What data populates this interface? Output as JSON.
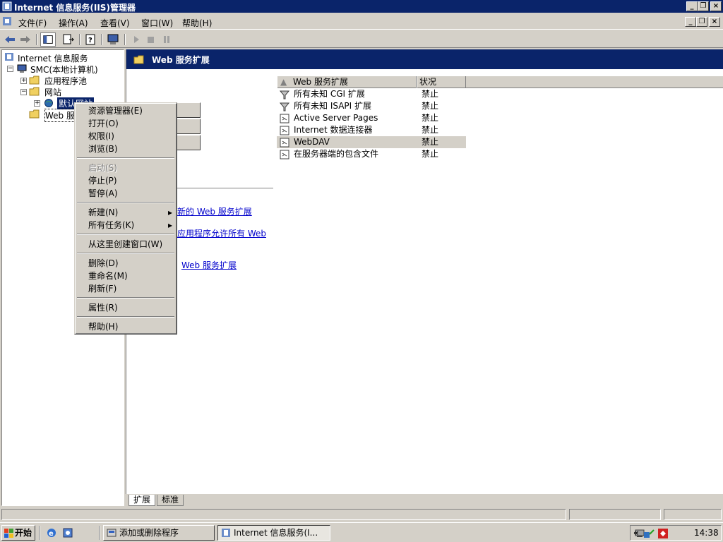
{
  "window": {
    "title": "Internet 信息服务(IIS)管理器"
  },
  "menu": [
    {
      "label": "文件(F)"
    },
    {
      "label": "操作(A)"
    },
    {
      "label": "查看(V)"
    },
    {
      "label": "窗口(W)"
    },
    {
      "label": "帮助(H)"
    }
  ],
  "tree": {
    "root": "Internet 信息服务",
    "computer": "SMC(本地计算机)",
    "apppool": "应用程序池",
    "websites": "网站",
    "default_site": "默认网站",
    "web_ext": "Web 服务扩展"
  },
  "right": {
    "header": "Web 服务扩展",
    "columns": {
      "name": "Web 服务扩展",
      "status": "状况"
    },
    "rows": [
      {
        "name": "所有未知 CGI 扩展",
        "status": "禁止",
        "icon": "filter-icon"
      },
      {
        "name": "所有未知 ISAPI 扩展",
        "status": "禁止",
        "icon": "filter-icon"
      },
      {
        "name": "Active Server Pages",
        "status": "禁止",
        "icon": "extension-icon"
      },
      {
        "name": "Internet 数据连接器",
        "status": "禁止",
        "icon": "extension-icon"
      },
      {
        "name": "WebDAV",
        "status": "禁止",
        "icon": "extension-icon"
      },
      {
        "name": "在服务器端的包含文件",
        "status": "禁止",
        "icon": "extension-icon"
      }
    ],
    "tasks": [
      "新的 Web 服务扩展",
      "应用程序允许所有 Web",
      "Web 服务扩展"
    ]
  },
  "tabs": [
    {
      "label": "扩展"
    },
    {
      "label": "标准"
    }
  ],
  "context_menu": [
    {
      "label": "资源管理器(E)",
      "disabled": false
    },
    {
      "label": "打开(O)",
      "disabled": false
    },
    {
      "label": "权限(I)",
      "disabled": false
    },
    {
      "label": "浏览(B)",
      "disabled": false
    },
    {
      "label": "启动(S)",
      "disabled": true
    },
    {
      "label": "停止(P)",
      "disabled": false
    },
    {
      "label": "暂停(A)",
      "disabled": false
    },
    {
      "label": "新建(N)",
      "disabled": false,
      "submenu": true
    },
    {
      "label": "所有任务(K)",
      "disabled": false,
      "submenu": true
    },
    {
      "label": "从这里创建窗口(W)",
      "disabled": false
    },
    {
      "label": "删除(D)",
      "disabled": false
    },
    {
      "label": "重命名(M)",
      "disabled": false
    },
    {
      "label": "刷新(F)",
      "disabled": false
    },
    {
      "label": "属性(R)",
      "disabled": false
    },
    {
      "label": "帮助(H)",
      "disabled": false
    }
  ],
  "taskbar": {
    "start": "开始",
    "apps": [
      {
        "label": "添加或删除程序"
      },
      {
        "label": "Internet 信息服务(I..."
      }
    ],
    "time": "14:38",
    "tray_expand": "«"
  },
  "colors": {
    "titlebar": "#0a246a",
    "face": "#d4d0c8",
    "link": "#0000cc"
  }
}
